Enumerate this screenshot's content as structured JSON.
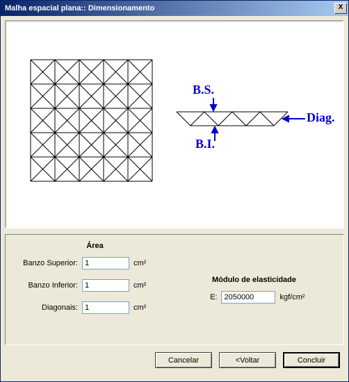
{
  "window": {
    "title": "Malha espacial plana:: Dimensionamento",
    "close_icon": "X"
  },
  "diagram": {
    "label_bs": "B.S.",
    "label_bi": "B.I.",
    "label_diag": "Diag."
  },
  "form": {
    "area": {
      "heading": "Área",
      "banzo_superior": {
        "label": "Banzo Superior:",
        "value": "1",
        "unit": "cm²"
      },
      "banzo_inferior": {
        "label": "Banzo Inferior:",
        "value": "1",
        "unit": "cm²"
      },
      "diagonais": {
        "label": "Diagonais:",
        "value": "1",
        "unit": "cm²"
      }
    },
    "modulus": {
      "heading": "Módulo de elasticidade",
      "label": "E:",
      "value": "2050000",
      "unit": "kgf/cm²"
    }
  },
  "buttons": {
    "cancelar": "Cancelar",
    "voltar": "<Voltar",
    "concluir": "Concluir"
  }
}
